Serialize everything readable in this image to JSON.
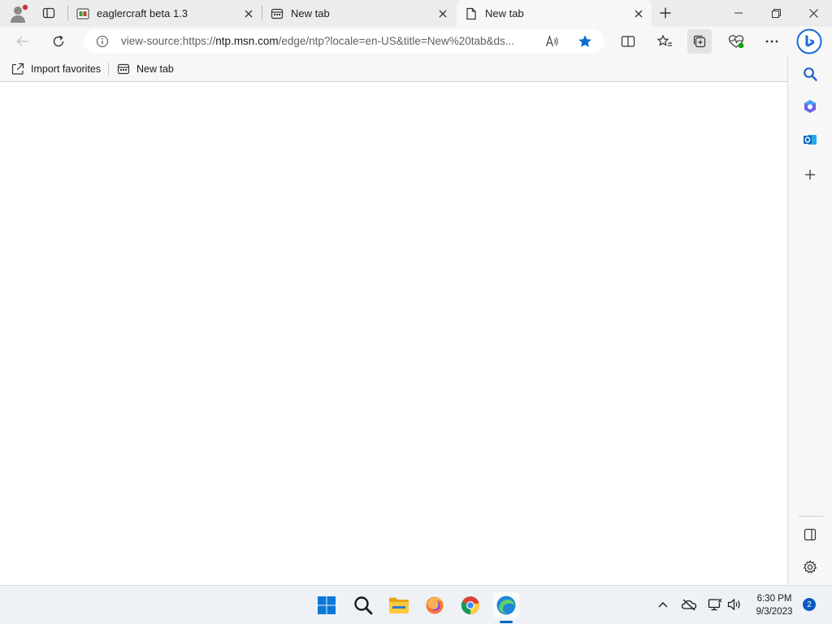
{
  "browser": {
    "tabs": [
      {
        "title": "eaglercraft beta 1.3",
        "icon": "eaglercraft-favicon",
        "active": false
      },
      {
        "title": "New tab",
        "icon": "newtab-favicon",
        "active": false
      },
      {
        "title": "New tab",
        "icon": "page-favicon",
        "active": true
      }
    ],
    "address_bar": {
      "url_prefix": "view-source:https://",
      "url_host": "ntp.msn.com",
      "url_rest": "/edge/ntp?locale=en-US&title=New%20tab&ds..."
    },
    "favorites_bar": [
      {
        "label": "Import favorites",
        "icon": "import-favorites-icon"
      },
      {
        "label": "New tab",
        "icon": "newtab-favicon"
      }
    ],
    "favorite_starred": true,
    "colors": {
      "accent": "#0a6ed1",
      "tab_strip": "#ececec",
      "toolbar": "#f7f7f7"
    }
  },
  "sidebar": {
    "items": [
      "search-icon",
      "copilot-icon",
      "outlook-icon",
      "add-icon"
    ],
    "bottom_items": [
      "sidebar-toggle-icon",
      "settings-icon"
    ]
  },
  "taskbar": {
    "apps": [
      "start-icon",
      "search-icon",
      "file-explorer-icon",
      "firefox-icon",
      "chrome-icon",
      "edge-icon"
    ],
    "tray": [
      "chevron-up-icon",
      "onedrive-offline-icon",
      "network-icon",
      "volume-icon"
    ],
    "time": "6:30 PM",
    "date": "9/3/2023",
    "notification_count": "2"
  }
}
